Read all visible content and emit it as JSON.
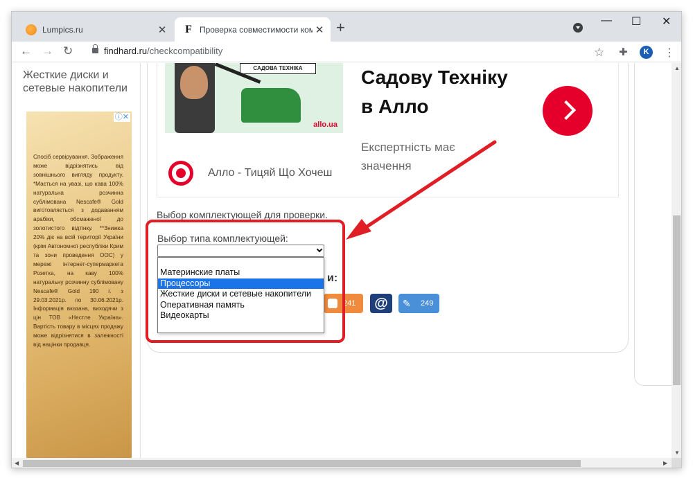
{
  "browser": {
    "tabs": [
      {
        "title": "Lumpics.ru",
        "active": false
      },
      {
        "title": "Проверка совместимости комп",
        "active": true
      }
    ],
    "new_tab_symbol": "+",
    "tab_close_symbol": "✕",
    "controls": {
      "minimize": "—",
      "maximize": "☐",
      "close": "✕"
    },
    "url_host": "findhard.ru",
    "url_path": "/checkcompatibility",
    "nav": {
      "back": "←",
      "forward": "→",
      "reload": "↻"
    },
    "bookmark_symbol": "☆",
    "extensions_symbol": "✚",
    "profile_letter": "K",
    "menu_symbol": "⋮"
  },
  "sidebar": {
    "heading": "Жесткие диски и сетевые накопители",
    "ad_badge": "ⓘ✕",
    "ad_text": "Спосіб сервірування. Зображення може відрізнятись від зовнішнього вигляду продукту. *Мається на увазі, що кава 100% натуральна розчинна сублімована Nescafe® Gold виготовляється з додаванням арабіки, обсмаженої до золотистого відтінку. **Знижка 20% діє на всій території України (крім Автономної республіки Крим та зони проведення ООС) у мережі інтернет-супермаркета Розетка, на каву 100% натуральну розчинну сублімовану Nescafe® Gold 190 г. з 29.03.2021р. по 30.06.2021р. Інформація вказана, виходячи з цін ТОВ «Нестле Україна». Вартість товару в місцях продажу може відрізнятися в залежності від націнки продавця."
  },
  "ad": {
    "banner_text": "САДОВА ТЕХНІКА",
    "small_brand": "allo.ua",
    "headline": "Садову Техніку в Алло",
    "subtext": "Експертність має значення",
    "brand_line": "Алло - Тицяй Що Хочеш"
  },
  "form": {
    "section_label": "Выбор комплектующей для проверки.",
    "field_label": "Выбор типа комплектующей:",
    "selected_value": "",
    "options": [
      "Материнские платы",
      "Процессоры",
      "Жесткие диски и сетевые накопители",
      "Оперативная память",
      "Видеокарты"
    ],
    "highlighted_index": 1
  },
  "share": {
    "fragment": "и:",
    "blogger_count": "241",
    "mail_symbol": "@",
    "edit_count": "249"
  },
  "colors": {
    "accent_red": "#e01e25",
    "selection_blue": "#1a73e8",
    "allo_red": "#e4002b"
  }
}
